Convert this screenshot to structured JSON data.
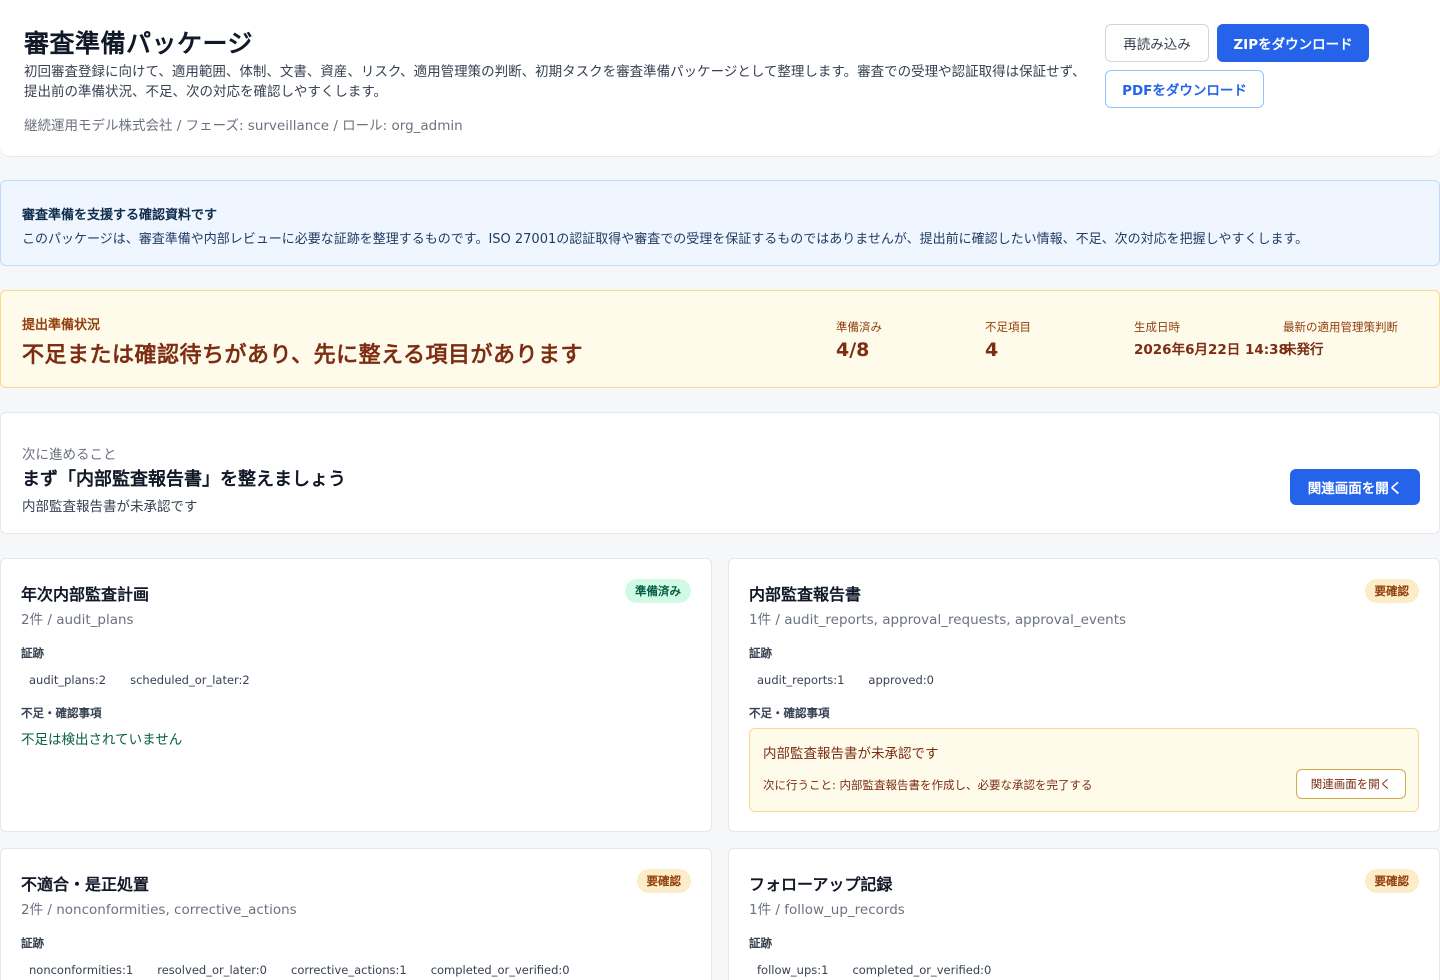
{
  "header": {
    "title": "審査準備パッケージ",
    "description": "初回審査登録に向けて、適用範囲、体制、文書、資産、リスク、適用管理策の判断、初期タスクを審査準備パッケージとして整理します。審査での受理や認証取得は保証せず、提出前の準備状況、不足、次の対応を確認しやすくします。",
    "meta": "継続運用モデル株式会社 / フェーズ: surveillance / ロール: org_admin",
    "reload_label": "再読み込み",
    "zip_label": "ZIPをダウンロード",
    "pdf_label": "PDFをダウンロード"
  },
  "notice": {
    "title": "審査準備を支援する確認資料です",
    "body": "このパッケージは、審査準備や内部レビューに必要な証跡を整理するものです。ISO 27001の認証取得や審査での受理を保証するものではありませんが、提出前に確認したい情報、不足、次の対応を把握しやすくします。"
  },
  "status": {
    "label": "提出準備状況",
    "headline": "不足または確認待ちがあり、先に整える項目があります",
    "metrics": [
      {
        "label": "準備済み",
        "value": "4/8"
      },
      {
        "label": "不足項目",
        "value": "4"
      },
      {
        "label": "生成日時",
        "value": "2026年6月22日 14:38"
      },
      {
        "label": "最新の適用管理策判断",
        "value": "未発行"
      }
    ],
    "colors": {
      "background": "#fffbeb",
      "text": "#7c2d12"
    }
  },
  "next_step": {
    "label": "次に進めること",
    "title": "まず「内部監査報告書」を整えましょう",
    "description": "内部監査報告書が未承認です",
    "button_label": "関連画面を開く"
  },
  "common": {
    "evidence_label": "証跡",
    "issues_label": "不足・確認事項",
    "no_issues": "不足は検出されていません",
    "open_related": "関連画面を開く"
  },
  "cards": [
    {
      "title": "年次内部監査計画",
      "subtitle": "2件 / audit_plans",
      "badge": "準備済み",
      "evidence": [
        "audit_plans:2",
        "scheduled_or_later:2"
      ]
    },
    {
      "title": "内部監査報告書",
      "subtitle": "1件 / audit_reports, approval_requests, approval_events",
      "badge": "要確認",
      "evidence": [
        "audit_reports:1",
        "approved:0"
      ],
      "issue": {
        "title": "内部監査報告書が未承認です",
        "action": "次に行うこと: 内部監査報告書を作成し、必要な承認を完了する"
      }
    },
    {
      "title": "不適合・是正処置",
      "subtitle": "2件 / nonconformities, corrective_actions",
      "badge": "要確認",
      "evidence": [
        "nonconformities:1",
        "resolved_or_later:0",
        "corrective_actions:1",
        "completed_or_verified:0"
      ]
    },
    {
      "title": "フォローアップ記録",
      "subtitle": "1件 / follow_up_records",
      "badge": "要確認",
      "evidence": [
        "follow_ups:1",
        "completed_or_verified:0"
      ]
    }
  ],
  "colors": {
    "accent": "#2563eb",
    "ready_badge": "#d1fae5",
    "check_badge": "#fdecc8"
  }
}
